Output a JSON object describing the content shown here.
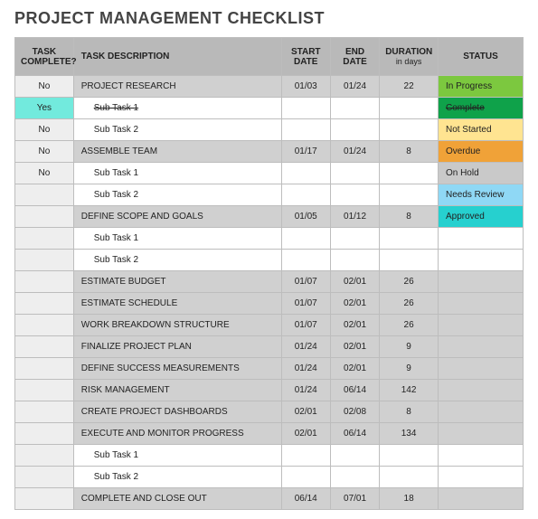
{
  "title": "PROJECT MANAGEMENT CHECKLIST",
  "headers": {
    "task_complete": "TASK COMPLETE?",
    "task_description": "TASK DESCRIPTION",
    "start_date": "START DATE",
    "end_date": "END DATE",
    "duration": "DURATION",
    "duration_sub": "in days",
    "status": "STATUS"
  },
  "rows": [
    {
      "complete": "No",
      "desc": "PROJECT RESEARCH",
      "indent": false,
      "strike": false,
      "start": "01/03",
      "end": "01/24",
      "duration": "22",
      "status": "In Progress",
      "status_class": "st-inprogress",
      "shade": "gray",
      "complete_class": "lite",
      "yes": false
    },
    {
      "complete": "Yes",
      "desc": "Sub Task 1",
      "indent": true,
      "strike": true,
      "start": "",
      "end": "",
      "duration": "",
      "status": "Complete",
      "status_class": "st-complete",
      "shade": "white",
      "complete_class": "",
      "yes": true
    },
    {
      "complete": "No",
      "desc": "Sub Task 2",
      "indent": true,
      "strike": false,
      "start": "",
      "end": "",
      "duration": "",
      "status": "Not Started",
      "status_class": "st-notstarted",
      "shade": "white",
      "complete_class": "lite",
      "yes": false
    },
    {
      "complete": "No",
      "desc": "ASSEMBLE TEAM",
      "indent": false,
      "strike": false,
      "start": "01/17",
      "end": "01/24",
      "duration": "8",
      "status": "Overdue",
      "status_class": "st-overdue",
      "shade": "gray",
      "complete_class": "lite",
      "yes": false
    },
    {
      "complete": "No",
      "desc": "Sub Task 1",
      "indent": true,
      "strike": false,
      "start": "",
      "end": "",
      "duration": "",
      "status": "On Hold",
      "status_class": "st-onhold",
      "shade": "white",
      "complete_class": "lite",
      "yes": false
    },
    {
      "complete": "",
      "desc": "Sub Task 2",
      "indent": true,
      "strike": false,
      "start": "",
      "end": "",
      "duration": "",
      "status": "Needs Review",
      "status_class": "st-needs",
      "shade": "white",
      "complete_class": "lite",
      "yes": false
    },
    {
      "complete": "",
      "desc": "DEFINE SCOPE AND GOALS",
      "indent": false,
      "strike": false,
      "start": "01/05",
      "end": "01/12",
      "duration": "8",
      "status": "Approved",
      "status_class": "st-approved",
      "shade": "gray",
      "complete_class": "lite",
      "yes": false
    },
    {
      "complete": "",
      "desc": "Sub Task 1",
      "indent": true,
      "strike": false,
      "start": "",
      "end": "",
      "duration": "",
      "status": "",
      "status_class": "",
      "shade": "white",
      "complete_class": "lite",
      "yes": false
    },
    {
      "complete": "",
      "desc": "Sub Task 2",
      "indent": true,
      "strike": false,
      "start": "",
      "end": "",
      "duration": "",
      "status": "",
      "status_class": "",
      "shade": "white",
      "complete_class": "lite",
      "yes": false
    },
    {
      "complete": "",
      "desc": "ESTIMATE BUDGET",
      "indent": false,
      "strike": false,
      "start": "01/07",
      "end": "02/01",
      "duration": "26",
      "status": "",
      "status_class": "",
      "shade": "gray",
      "complete_class": "lite",
      "yes": false
    },
    {
      "complete": "",
      "desc": "ESTIMATE SCHEDULE",
      "indent": false,
      "strike": false,
      "start": "01/07",
      "end": "02/01",
      "duration": "26",
      "status": "",
      "status_class": "",
      "shade": "gray",
      "complete_class": "lite",
      "yes": false
    },
    {
      "complete": "",
      "desc": "WORK BREAKDOWN STRUCTURE",
      "indent": false,
      "strike": false,
      "start": "01/07",
      "end": "02/01",
      "duration": "26",
      "status": "",
      "status_class": "",
      "shade": "gray",
      "complete_class": "lite",
      "yes": false
    },
    {
      "complete": "",
      "desc": "FINALIZE PROJECT PLAN",
      "indent": false,
      "strike": false,
      "start": "01/24",
      "end": "02/01",
      "duration": "9",
      "status": "",
      "status_class": "",
      "shade": "gray",
      "complete_class": "lite",
      "yes": false
    },
    {
      "complete": "",
      "desc": "DEFINE SUCCESS MEASUREMENTS",
      "indent": false,
      "strike": false,
      "start": "01/24",
      "end": "02/01",
      "duration": "9",
      "status": "",
      "status_class": "",
      "shade": "gray",
      "complete_class": "lite",
      "yes": false
    },
    {
      "complete": "",
      "desc": "RISK MANAGEMENT",
      "indent": false,
      "strike": false,
      "start": "01/24",
      "end": "06/14",
      "duration": "142",
      "status": "",
      "status_class": "",
      "shade": "gray",
      "complete_class": "lite",
      "yes": false
    },
    {
      "complete": "",
      "desc": "CREATE PROJECT DASHBOARDS",
      "indent": false,
      "strike": false,
      "start": "02/01",
      "end": "02/08",
      "duration": "8",
      "status": "",
      "status_class": "",
      "shade": "gray",
      "complete_class": "lite",
      "yes": false
    },
    {
      "complete": "",
      "desc": "EXECUTE AND MONITOR PROGRESS",
      "indent": false,
      "strike": false,
      "start": "02/01",
      "end": "06/14",
      "duration": "134",
      "status": "",
      "status_class": "",
      "shade": "gray",
      "complete_class": "lite",
      "yes": false
    },
    {
      "complete": "",
      "desc": "Sub Task 1",
      "indent": true,
      "strike": false,
      "start": "",
      "end": "",
      "duration": "",
      "status": "",
      "status_class": "",
      "shade": "white",
      "complete_class": "lite",
      "yes": false
    },
    {
      "complete": "",
      "desc": "Sub Task 2",
      "indent": true,
      "strike": false,
      "start": "",
      "end": "",
      "duration": "",
      "status": "",
      "status_class": "",
      "shade": "white",
      "complete_class": "lite",
      "yes": false
    },
    {
      "complete": "",
      "desc": "COMPLETE AND CLOSE OUT",
      "indent": false,
      "strike": false,
      "start": "06/14",
      "end": "07/01",
      "duration": "18",
      "status": "",
      "status_class": "",
      "shade": "gray",
      "complete_class": "lite",
      "yes": false
    }
  ]
}
